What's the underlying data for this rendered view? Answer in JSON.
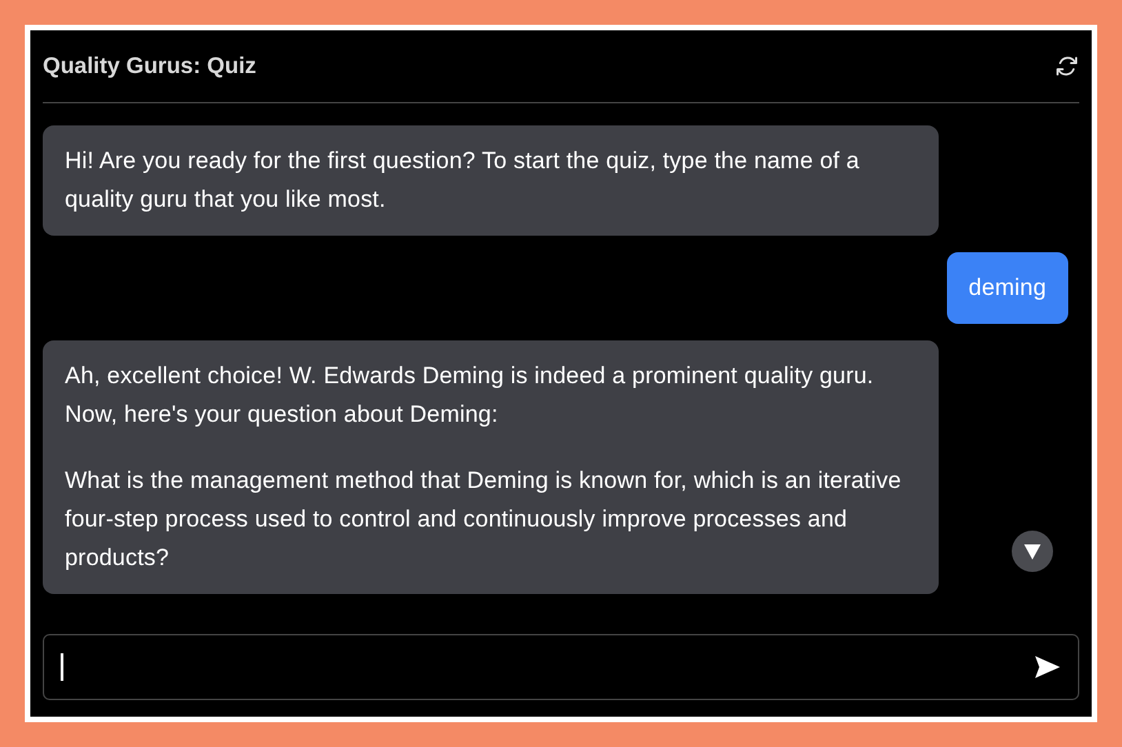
{
  "header": {
    "title": "Quality Gurus: Quiz"
  },
  "messages": [
    {
      "kind": "bot",
      "paragraphs": [
        "Hi! Are you ready for the first question? To start the quiz, type the name of a quality guru that you like most."
      ]
    },
    {
      "kind": "user",
      "paragraphs": [
        "deming"
      ]
    },
    {
      "kind": "bot",
      "paragraphs": [
        "Ah, excellent choice! W. Edwards Deming is indeed a prominent quality guru. Now, here's your question about Deming:",
        "What is the management method that Deming is known for, which is an iterative four-step process used to control and continuously improve processes and products?"
      ]
    }
  ]
}
